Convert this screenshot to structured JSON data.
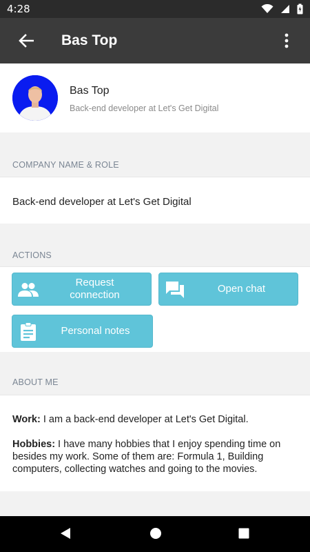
{
  "status_bar": {
    "time": "4:28"
  },
  "app_bar": {
    "title": "Bas Top"
  },
  "profile": {
    "name": "Bas Top",
    "subtitle": "Back-end developer at Let's Get Digital",
    "avatar_bg": "#0a1cf0"
  },
  "company": {
    "header": "COMPANY NAME & ROLE",
    "value": "Back-end developer at Let's Get Digital"
  },
  "actions": {
    "header": "ACTIONS",
    "request_line1": "Request",
    "request_line2": "connection",
    "chat": "Open chat",
    "notes": "Personal notes",
    "color": "#5fc4d9"
  },
  "about": {
    "header": "ABOUT ME",
    "work_label": "Work:",
    "work_text": " I am a back-end developer at Let's Get Digital.",
    "hobbies_label": "Hobbies:",
    "hobbies_text": " I have many hobbies that I enjoy spending time on besides my work. Some of them are: Formula 1, Building computers, collecting watches and going to the movies."
  }
}
